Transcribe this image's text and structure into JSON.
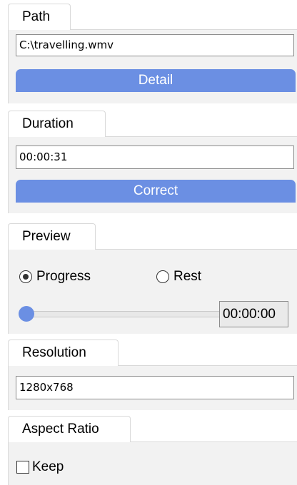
{
  "path": {
    "tab_label": "Path",
    "value": "C:\\travelling.wmv",
    "button_label": "Detail"
  },
  "duration": {
    "tab_label": "Duration",
    "value": "00:00:31",
    "button_label": "Correct"
  },
  "preview": {
    "tab_label": "Preview",
    "options": [
      {
        "label": "Progress",
        "selected": true
      },
      {
        "label": "Rest",
        "selected": false
      }
    ],
    "slider_value": 0,
    "time_value": "00:00:00"
  },
  "resolution": {
    "tab_label": "Resolution",
    "value": "1280x768"
  },
  "aspect_ratio": {
    "tab_label": "Aspect Ratio",
    "keep_label": "Keep",
    "keep_checked": false
  },
  "colors": {
    "accent": "#6b8fe3",
    "panel_bg": "#f2f2f2"
  }
}
